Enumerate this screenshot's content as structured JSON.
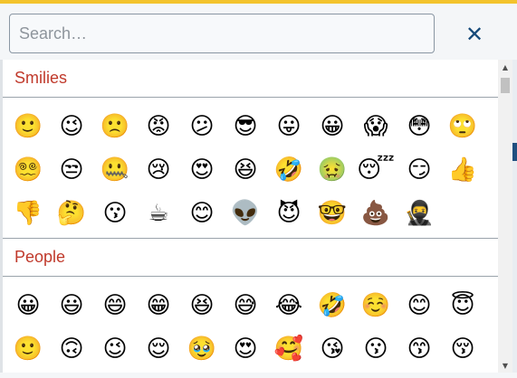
{
  "search": {
    "placeholder": "Search…",
    "value": ""
  },
  "close": {
    "symbol": "✕"
  },
  "sections": [
    {
      "title": "Smilies",
      "emojis": [
        "🙂",
        "😉",
        "🙁",
        "😡",
        "😕",
        "😎",
        "😛",
        "😀",
        "😱",
        "😳",
        "🙄",
        "😵‍💫",
        "😒",
        "🤐",
        "😢",
        "😍",
        "😆",
        "🤣",
        "🤢",
        "😴",
        "😏",
        "👍",
        "👎",
        "🤔",
        "😗",
        "☕",
        "😊",
        "👽",
        "😈",
        "🤓",
        "💩",
        "🥷"
      ]
    },
    {
      "title": "People",
      "emojis": [
        "😀",
        "😃",
        "😄",
        "😁",
        "😆",
        "😅",
        "😂",
        "🤣",
        "☺️",
        "😊",
        "😇",
        "🙂",
        "🙃",
        "😉",
        "😌",
        "🥹",
        "😍",
        "🥰",
        "😘",
        "😗",
        "😙",
        "😚"
      ]
    }
  ],
  "colors": {
    "accent_bar": "#f3c32c",
    "section_title": "#c0392b",
    "close_icon": "#164a7a"
  }
}
